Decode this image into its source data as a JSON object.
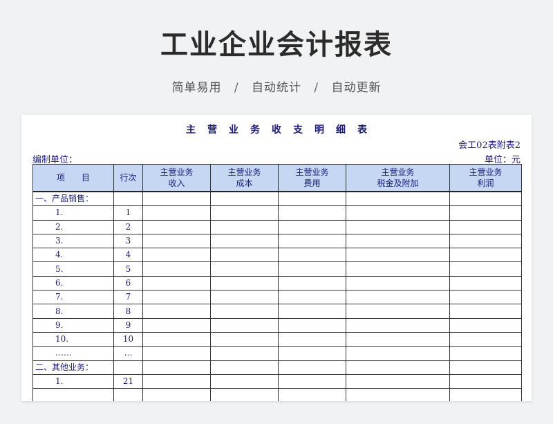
{
  "page": {
    "title": "工业企业会计报表",
    "tags": [
      "简单易用",
      "自动统计",
      "自动更新"
    ],
    "separator": "/"
  },
  "doc": {
    "title": "主营业务收支明细表",
    "form_code": "会工02表附表2",
    "unit_left": "编制单位：",
    "unit_right": "单位：元"
  },
  "table": {
    "headers": [
      {
        "line1": "项　　目",
        "line2": ""
      },
      {
        "line1": "行次",
        "line2": ""
      },
      {
        "line1": "主营业务",
        "line2": "收入"
      },
      {
        "line1": "主营业务",
        "line2": "成本"
      },
      {
        "line1": "主营业务",
        "line2": "费用"
      },
      {
        "line1": "主营业务",
        "line2": "税金及附加"
      },
      {
        "line1": "主营业务",
        "line2": "利润"
      }
    ],
    "rows": [
      {
        "item": "一、产品销售：",
        "no": "",
        "indent": false
      },
      {
        "item": "1.",
        "no": "1",
        "indent": true
      },
      {
        "item": "2.",
        "no": "2",
        "indent": true
      },
      {
        "item": "3.",
        "no": "3",
        "indent": true
      },
      {
        "item": "4.",
        "no": "4",
        "indent": true
      },
      {
        "item": "5.",
        "no": "5",
        "indent": true
      },
      {
        "item": "6.",
        "no": "6",
        "indent": true
      },
      {
        "item": "7.",
        "no": "7",
        "indent": true
      },
      {
        "item": "8.",
        "no": "8",
        "indent": true
      },
      {
        "item": "9.",
        "no": "9",
        "indent": true
      },
      {
        "item": "10.",
        "no": "10",
        "indent": true
      },
      {
        "item": "……",
        "no": "…",
        "indent": true
      },
      {
        "item": "二、其他业务：",
        "no": "",
        "indent": false
      },
      {
        "item": "1.",
        "no": "21",
        "indent": true
      },
      {
        "item": "",
        "no": "",
        "indent": true
      }
    ]
  }
}
